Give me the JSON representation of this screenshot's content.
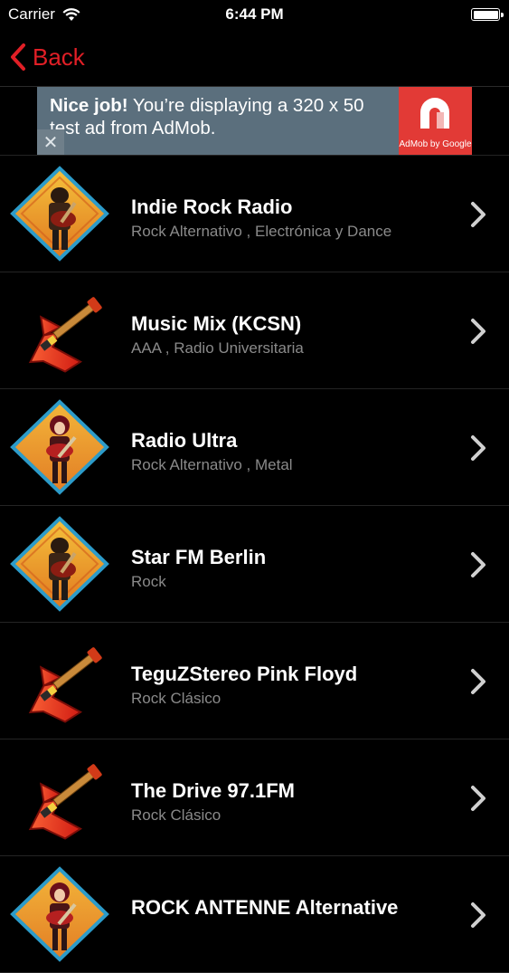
{
  "status_bar": {
    "carrier": "Carrier",
    "time": "6:44 PM"
  },
  "nav": {
    "back_label": "Back",
    "accent_color": "#e11f26"
  },
  "ad": {
    "headline": "Nice job!",
    "body": " You’re displaying a 320 x 50 test ad from AdMob.",
    "logo_caption": "AdMob by Google",
    "close_symbol": "✕"
  },
  "stations": [
    {
      "title": "Indie Rock Radio",
      "subtitle": "Rock Alternativo , Electrónica y Dance",
      "icon": "rocker-diamond-icon"
    },
    {
      "title": "Music Mix (KCSN)",
      "subtitle": "AAA , Radio Universitaria",
      "icon": "red-guitar-icon"
    },
    {
      "title": "Radio Ultra",
      "subtitle": "Rock Alternativo , Metal",
      "icon": "female-rocker-diamond-icon"
    },
    {
      "title": "Star FM Berlin",
      "subtitle": "Rock",
      "icon": "rocker-diamond-icon"
    },
    {
      "title": "TeguZStereo Pink Floyd",
      "subtitle": "Rock Clásico",
      "icon": "red-guitar-icon"
    },
    {
      "title": "The Drive 97.1FM",
      "subtitle": "Rock Clásico",
      "icon": "red-guitar-icon"
    },
    {
      "title": "ROCK ANTENNE Alternative",
      "subtitle": "",
      "icon": "female-rocker-diamond-icon"
    }
  ]
}
